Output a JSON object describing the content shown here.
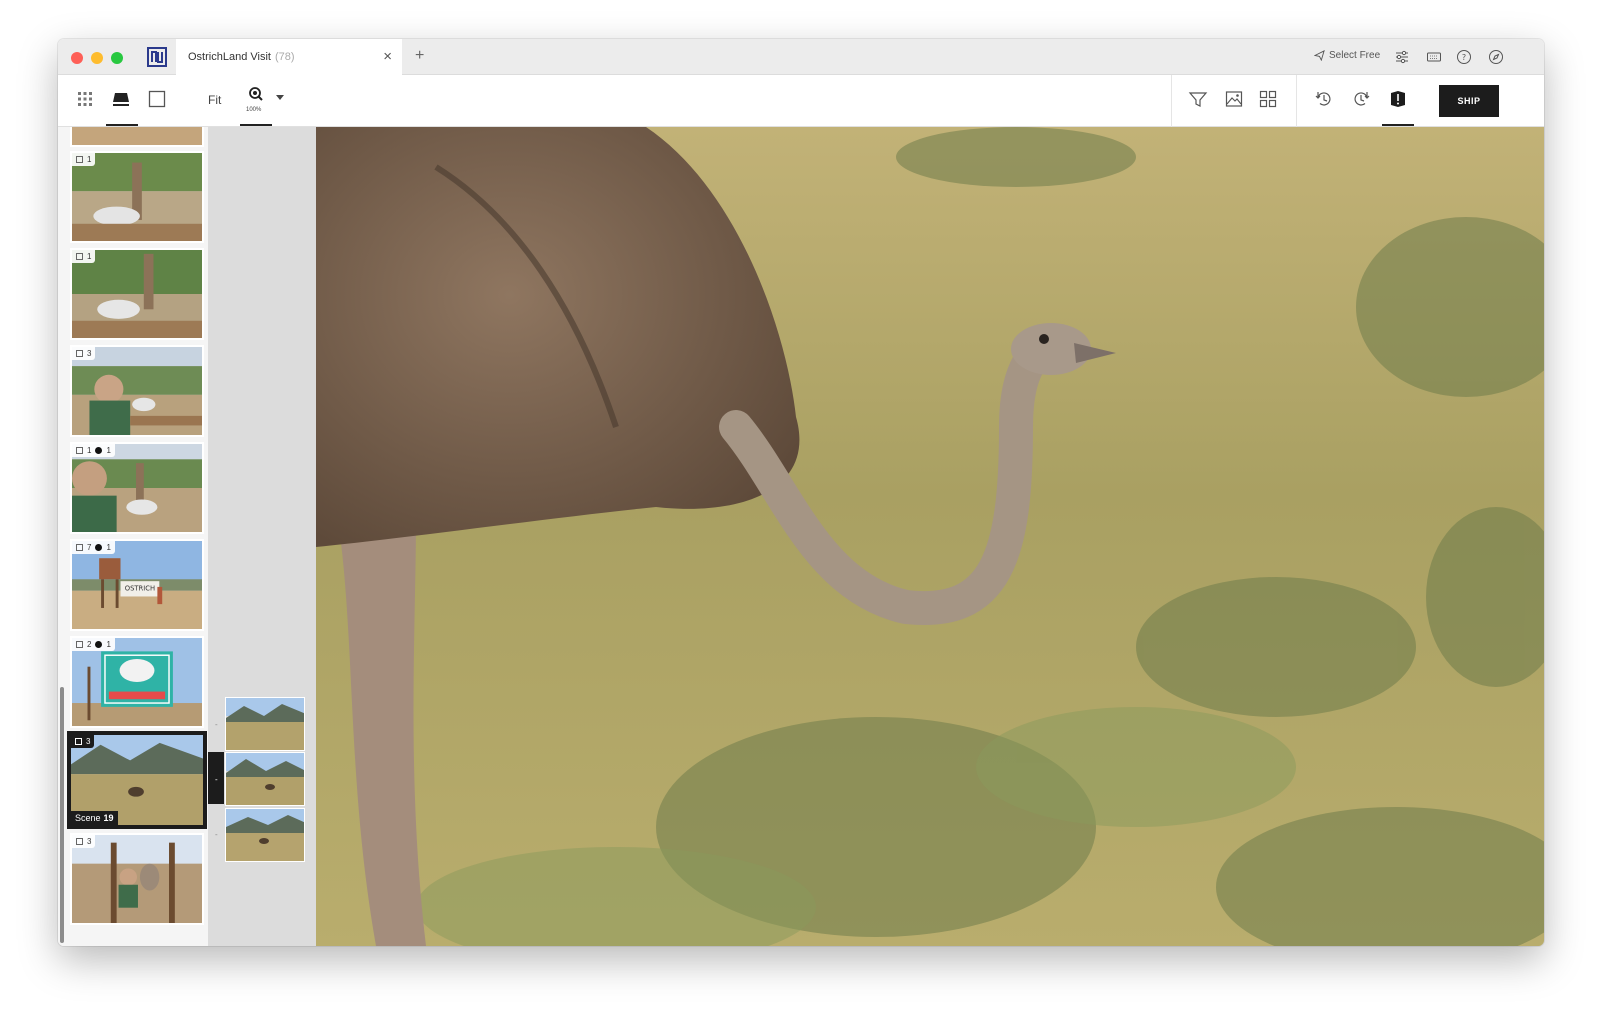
{
  "window": {
    "tab": {
      "title": "OstrichLand Visit",
      "count": "(78)"
    },
    "select_free": "Select Free"
  },
  "toolbar": {
    "fit_label": "Fit",
    "zoom_label": "100%",
    "ship_label": "SHIP"
  },
  "sidebar": {
    "thumbnails": [
      {
        "badge": "1",
        "dot": ""
      },
      {
        "badge": "1",
        "dot": ""
      },
      {
        "badge": "3",
        "dot": ""
      },
      {
        "badge": "1",
        "dot": "1"
      },
      {
        "badge": "7",
        "dot": "1"
      },
      {
        "badge": "2",
        "dot": "1"
      },
      {
        "badge": "3",
        "dot": "",
        "scene_label": "Scene",
        "scene_number": "19"
      },
      {
        "badge": "3",
        "dot": ""
      }
    ]
  },
  "filmstrip": {
    "frame_marks": [
      "-",
      "-",
      "-"
    ]
  },
  "icons": [
    "grid-icon",
    "filmstrip-view-icon",
    "single-view-icon",
    "zoom-icon",
    "filter-icon",
    "image-compare-icon",
    "tiles-icon",
    "sort-desc-icon",
    "history-icon",
    "flag-icon",
    "paper-plane-icon",
    "sliders-icon",
    "keyboard-icon",
    "help-icon",
    "compass-icon",
    "close-icon",
    "plus-icon"
  ],
  "colors": {
    "ship_bg": "#1c1c1c",
    "accent_logo": "#2b3a8c"
  }
}
